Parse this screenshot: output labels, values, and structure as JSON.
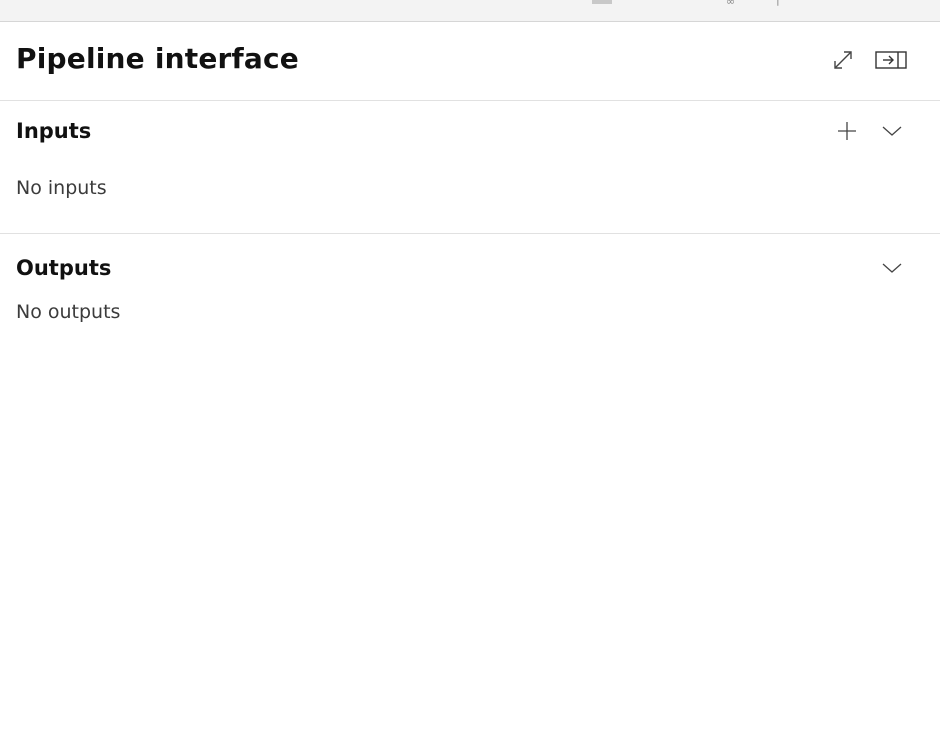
{
  "panel": {
    "title": "Pipeline interface",
    "icons": {
      "expand": "expand-icon",
      "dock": "dock-panel-icon"
    }
  },
  "inputs": {
    "title": "Inputs",
    "empty_text": "No inputs",
    "icons": {
      "add": "plus-icon",
      "collapse": "chevron-down-icon"
    }
  },
  "outputs": {
    "title": "Outputs",
    "empty_text": "No outputs",
    "icons": {
      "collapse": "chevron-down-icon"
    }
  },
  "colors": {
    "divider": "#e1e1e1",
    "text_primary": "#111111",
    "text_secondary": "#3b3b3b",
    "icon": "#444444"
  }
}
